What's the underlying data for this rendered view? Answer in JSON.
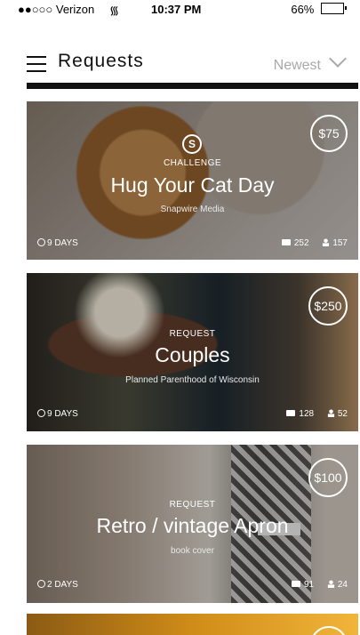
{
  "status_bar": {
    "carrier": "●●○○○ Verizon",
    "time": "10:37 PM",
    "battery": "66%"
  },
  "nav": {
    "title": "Requests",
    "sort": "Newest"
  },
  "cards": [
    {
      "kind": "CHALLENGE",
      "title": "Hug Your Cat Day",
      "client": "Snapwire Media",
      "price": "$75",
      "days": "9 DAYS",
      "photos": "252",
      "users": "157"
    },
    {
      "kind": "REQUEST",
      "title": "Couples",
      "client": "Planned Parenthood of Wisconsin",
      "price": "$250",
      "days": "9 DAYS",
      "photos": "128",
      "users": "52"
    },
    {
      "kind": "REQUEST",
      "title": "Retro / vintage Apron",
      "client": "book cover",
      "price": "$100",
      "days": "2 DAYS",
      "photos": "91",
      "users": "24"
    }
  ]
}
